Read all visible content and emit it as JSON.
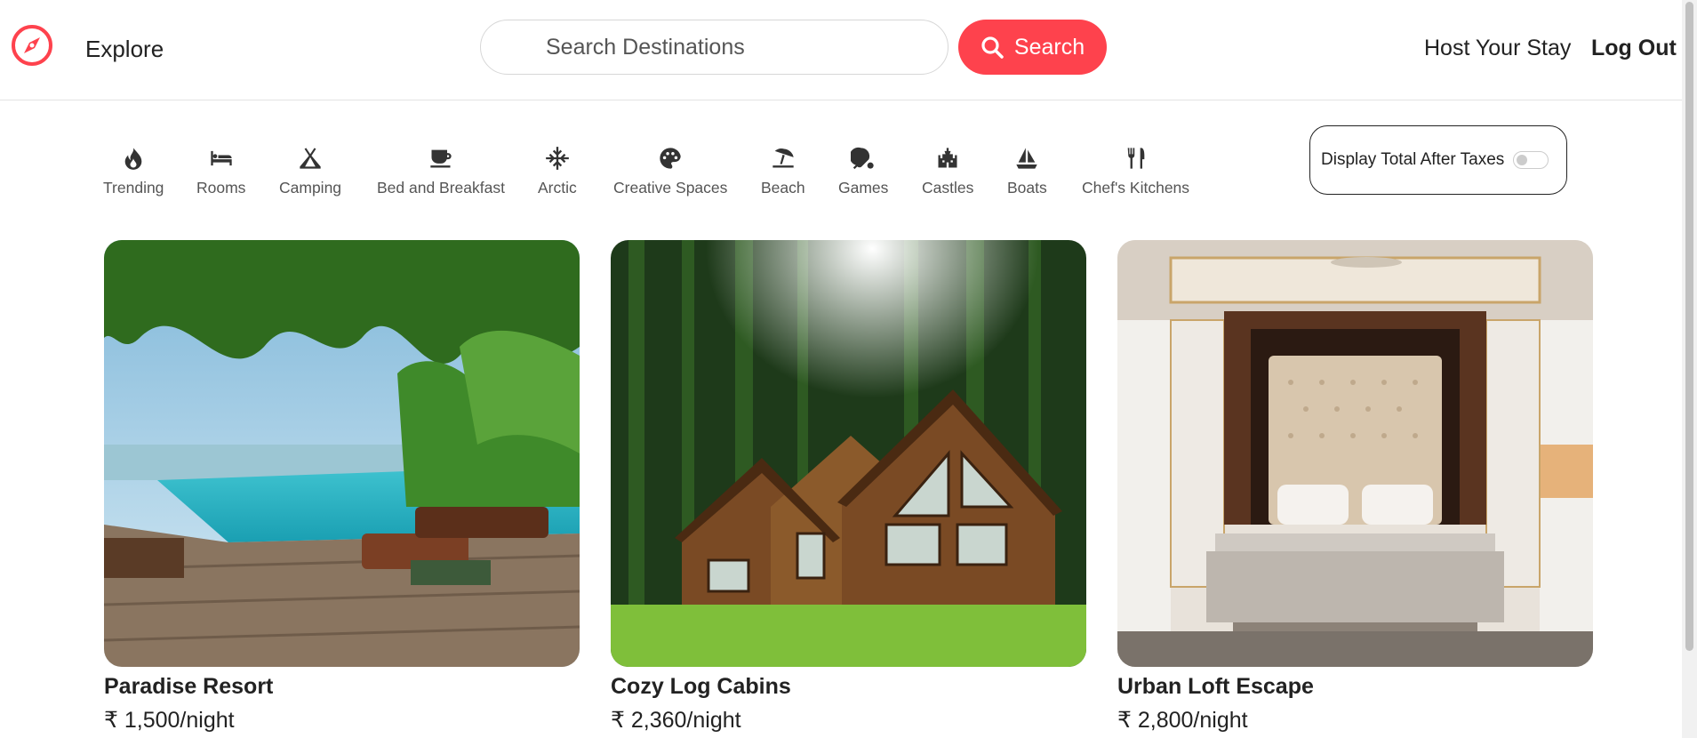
{
  "nav": {
    "logo_icon": "compass-icon",
    "explore_label": "Explore",
    "search_placeholder": "Search Destinations",
    "search_button_label": "Search",
    "host_label": "Host Your Stay",
    "logout_label": "Log Out",
    "brand_color": "#fe424d"
  },
  "filters": [
    {
      "label": "Trending",
      "icon": "fire-icon"
    },
    {
      "label": "Rooms",
      "icon": "bed-icon"
    },
    {
      "label": "Camping",
      "icon": "tent-icon"
    },
    {
      "label": "Bed and Breakfast",
      "icon": "mug-icon"
    },
    {
      "label": "Arctic",
      "icon": "snowflake-icon"
    },
    {
      "label": "Creative Spaces",
      "icon": "palette-icon"
    },
    {
      "label": "Beach",
      "icon": "umbrella-beach-icon"
    },
    {
      "label": "Games",
      "icon": "ping-pong-icon"
    },
    {
      "label": "Castles",
      "icon": "castle-icon"
    },
    {
      "label": "Boats",
      "icon": "sailboat-icon"
    },
    {
      "label": "Chef's Kitchens",
      "icon": "utensils-icon"
    }
  ],
  "tax_toggle": {
    "label": "Display Total After Taxes",
    "enabled": false
  },
  "listings": [
    {
      "title": "Paradise Resort",
      "price": "₹ 1,500/night",
      "image": "resort-pool-image"
    },
    {
      "title": "Cozy Log Cabins",
      "price": "₹ 2,360/night",
      "image": "forest-cabin-image"
    },
    {
      "title": "Urban Loft Escape",
      "price": "₹ 2,800/night",
      "image": "luxury-bedroom-image"
    }
  ]
}
